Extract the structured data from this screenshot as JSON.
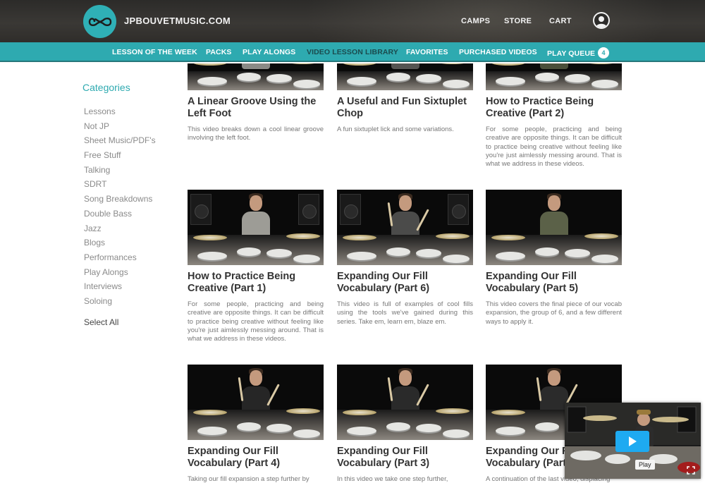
{
  "header": {
    "site_name": "JPBOUVETMUSIC.COM",
    "links": [
      "CAMPS",
      "STORE",
      "CART"
    ],
    "logo_icon": "infinity-icon",
    "user_icon": "user-avatar-icon"
  },
  "nav": {
    "items": [
      "LESSON OF THE WEEK",
      "PACKS",
      "PLAY ALONGS",
      "VIDEO LESSON LIBRARY",
      "FAVORITES",
      "PURCHASED VIDEOS",
      "PLAY QUEUE"
    ],
    "active": "VIDEO LESSON LIBRARY",
    "queue_count": "4"
  },
  "sidebar": {
    "title": "Categories",
    "categories": [
      "Lessons",
      "Not JP",
      "Sheet Music/PDF's",
      "Free Stuff",
      "Talking",
      "SDRT",
      "Song Breakdowns",
      "Double Bass",
      "Jazz",
      "Blogs",
      "Performances",
      "Play Alongs",
      "Interviews",
      "Soloing"
    ],
    "select_all": "Select All"
  },
  "videos": [
    {
      "title": "A Linear Groove Using the Left Foot",
      "desc": "This video breaks down a cool linear groove involving the left foot."
    },
    {
      "title": "A Useful and Fun Sixtuplet Chop",
      "desc": "A fun sixtuplet lick and some variations."
    },
    {
      "title": "How to Practice Being Creative (Part 2)",
      "desc": "For some people, practicing and being creative are opposite things. It can be difficult to practice being creative without feeling like you're just aimlessly messing around. That is what we address in these videos."
    },
    {
      "title": "How to Practice Being Creative (Part 1)",
      "desc": "For some people, practicing and being creative are opposite things. It can be difficult to practice being creative without feeling like you're just aimlessly messing around. That is what we address in these videos."
    },
    {
      "title": "Expanding Our Fill Vocabulary (Part 6)",
      "desc": "This video is full of examples of cool fills using the tools we've gained during this series. Take em, learn em, blaze em."
    },
    {
      "title": "Expanding Our Fill Vocabulary (Part 5)",
      "desc": "This video covers the final piece of our vocab expansion, the group of 6, and a few different ways to apply it."
    },
    {
      "title": "Expanding Our Fill Vocabulary (Part 4)",
      "desc": "Taking our fill expansion a step further by"
    },
    {
      "title": "Expanding Our Fill Vocabulary (Part 3)",
      "desc": "In this video we take one step further,"
    },
    {
      "title": "Expanding Our Fill Vocabulary (Part 2)",
      "desc": "A continuation of the last video, displacing"
    }
  ],
  "mini_player": {
    "play_label": "Play",
    "play_icon": "play-icon",
    "fullscreen_icon": "fullscreen-icon"
  },
  "colors": {
    "accent": "#2eaab0",
    "header_bg": "#333230",
    "play_button": "#1eaaf1"
  }
}
